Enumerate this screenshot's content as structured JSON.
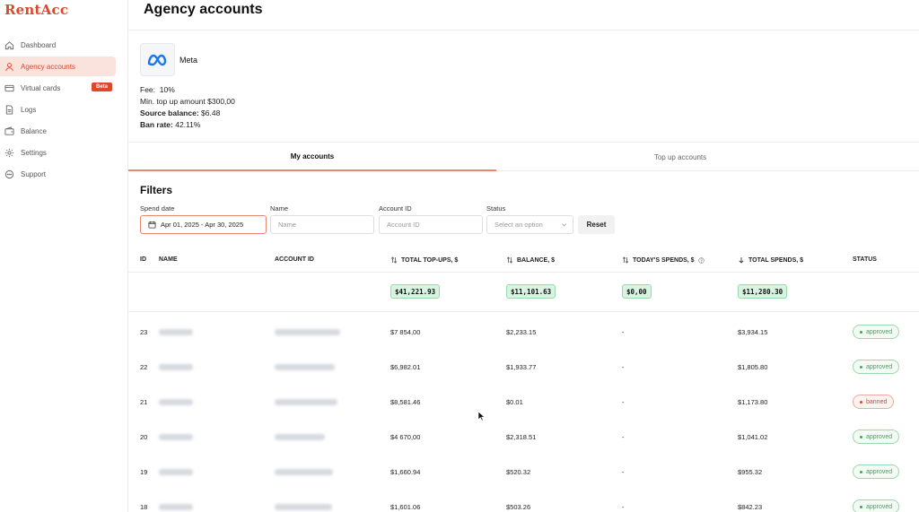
{
  "app": {
    "logo": "RentAcc"
  },
  "sidebar": {
    "items": [
      {
        "label": "Dashboard",
        "icon": "home-icon"
      },
      {
        "label": "Agency accounts",
        "icon": "user-icon",
        "active": true
      },
      {
        "label": "Virtual cards",
        "icon": "card-icon",
        "badge": "Beta"
      },
      {
        "label": "Logs",
        "icon": "file-icon"
      },
      {
        "label": "Balance",
        "icon": "wallet-icon"
      },
      {
        "label": "Settings",
        "icon": "gear-icon"
      },
      {
        "label": "Support",
        "icon": "chat-icon"
      }
    ]
  },
  "header": {
    "title": "Agency accounts"
  },
  "provider": {
    "name": "Meta",
    "fee_label": "Fee:",
    "fee_value": "10%",
    "min_label": "Min. top up amount",
    "min_value": "$300,00",
    "source_label": "Source balance:",
    "source_value": "$6.48",
    "ban_label": "Ban rate:",
    "ban_value": "42.11%"
  },
  "tabs": [
    {
      "label": "My accounts",
      "active": true
    },
    {
      "label": "Top up accounts"
    }
  ],
  "filters": {
    "title": "Filters",
    "spend_date_label": "Spend date",
    "spend_date_value": "Apr 01, 2025 - Apr 30, 2025",
    "name_label": "Name",
    "name_placeholder": "Name",
    "account_label": "Account ID",
    "account_placeholder": "Account ID",
    "status_label": "Status",
    "status_placeholder": "Select an option",
    "reset_label": "Reset"
  },
  "table": {
    "headers": {
      "id": "ID",
      "name": "NAME",
      "account_id": "ACCOUNT ID",
      "total_topups": "TOTAL TOP-UPS, $",
      "balance": "BALANCE, $",
      "todays_spends": "TODAY'S SPENDS, $",
      "total_spends": "TOTAL SPENDS, $",
      "status": "STATUS"
    },
    "totals": {
      "total_topups": "$41,221.93",
      "balance": "$11,101.63",
      "todays_spends": "$0,00",
      "total_spends": "$11,280.30"
    },
    "rows": [
      {
        "id": "23",
        "topups": "$7 854,00",
        "balance": "$2,233.15",
        "today": "-",
        "spends": "$3,934.15",
        "status": "approved"
      },
      {
        "id": "22",
        "topups": "$6,982.01",
        "balance": "$1,933.77",
        "today": "-",
        "spends": "$1,805.80",
        "status": "approved"
      },
      {
        "id": "21",
        "topups": "$8,581.46",
        "balance": "$0.01",
        "today": "-",
        "spends": "$1,173.80",
        "status": "banned"
      },
      {
        "id": "20",
        "topups": "$4 670,00",
        "balance": "$2,318.51",
        "today": "-",
        "spends": "$1,041.02",
        "status": "approved"
      },
      {
        "id": "19",
        "topups": "$1,660.94",
        "balance": "$520.32",
        "today": "-",
        "spends": "$955.32",
        "status": "approved"
      },
      {
        "id": "18",
        "topups": "$1,601.06",
        "balance": "$503.26",
        "today": "-",
        "spends": "$842.23",
        "status": "approved"
      }
    ]
  },
  "colors": {
    "accent": "#d9492e",
    "accent_soft": "#fbe3dd",
    "success": "#3ea75a",
    "success_bg": "#d8f3df"
  }
}
